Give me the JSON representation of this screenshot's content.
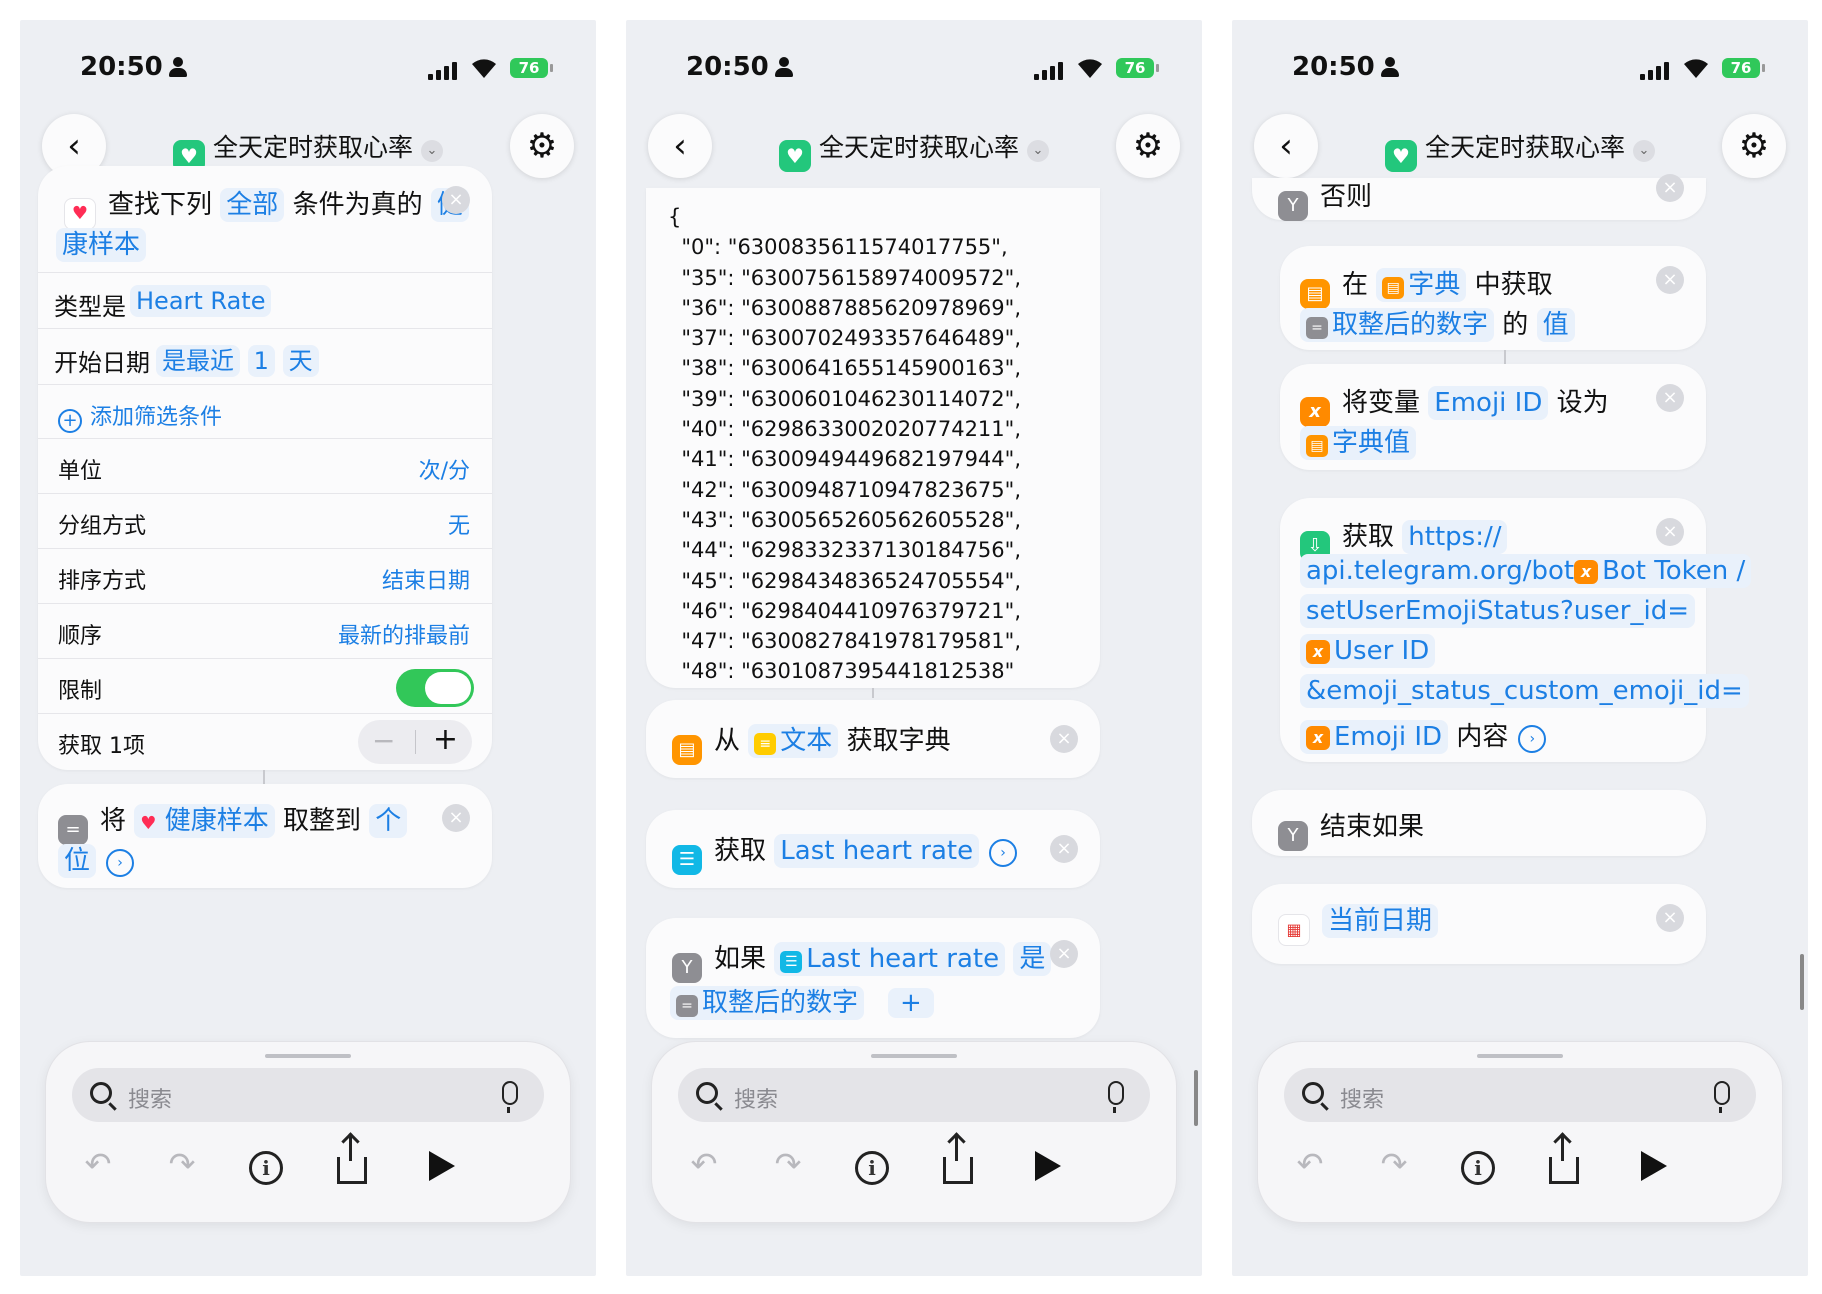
{
  "status": {
    "time": "20:50",
    "battery": "76"
  },
  "nav": {
    "title": "全天定时获取心率"
  },
  "search": {
    "placeholder": "搜索"
  },
  "p1": {
    "find": {
      "prefix": "查找下列",
      "all": "全部",
      "mid": "条件为真的",
      "tok_a": "健",
      "tok_b": "康样本"
    },
    "type": {
      "label": "类型是",
      "value": "Heart Rate"
    },
    "start": {
      "label": "开始日期",
      "op": "是最近",
      "num": "1",
      "unit": "天"
    },
    "add_filter": "添加筛选条件",
    "rows": [
      {
        "label": "单位",
        "value": "次/分"
      },
      {
        "label": "分组方式",
        "value": "无"
      },
      {
        "label": "排序方式",
        "value": "结束日期"
      },
      {
        "label": "顺序",
        "value": "最新的排最前"
      }
    ],
    "limit_label": "限制",
    "fetch_label": "获取 1项",
    "round": {
      "a": "将",
      "sample": "健康样本",
      "b": "取整到",
      "tok_a": "个",
      "tok_b": "位"
    }
  },
  "p2": {
    "json_lines": [
      "{",
      "  \"0\": \"6300835611574017755\",",
      "  \"35\": \"6300756158974009572\",",
      "  \"36\": \"6300887885620978969\",",
      "  \"37\": \"6300702493357646489\",",
      "  \"38\": \"6300641655145900163\",",
      "  \"39\": \"6300601046230114072\",",
      "  \"40\": \"6298633002020774211\",",
      "  \"41\": \"6300949449682197944\",",
      "  \"42\": \"6300948710947823675\",",
      "  \"43\": \"6300565260562605528\",",
      "  \"44\": \"6298332337130184756\",",
      "  \"45\": \"6298434836524705554\",",
      "  \"46\": \"6298404410976379721\",",
      "  \"47\": \"6300827841978179581\",",
      "  \"48\": \"6301087395441812538\""
    ],
    "dict": {
      "from": "从",
      "text": "文本",
      "get": "获取字典"
    },
    "getvar": {
      "get": "获取",
      "var": "Last heart rate"
    },
    "ifc": {
      "if": "如果",
      "var": "Last heart rate",
      "is": "是",
      "rounded": "取整后的数字"
    }
  },
  "p3": {
    "otherwise": "否则",
    "getval": {
      "in": "在",
      "dict": "字典",
      "mid": "中获取",
      "rounded": "取整后的数字",
      "of": "的",
      "val": "值"
    },
    "setvar": {
      "a": "将变量",
      "var": "Emoji ID",
      "b": "设为",
      "value": "字典值"
    },
    "url": {
      "get": "获取",
      "l1": "https://",
      "l2a": "api.telegram.org/bot",
      "bot": "Bot Token",
      "slash": "/",
      "l3": "setUserEmojiStatus?user_id=",
      "user": "User ID",
      "l5": "&emoji_status_custom_emoji_id=",
      "emoji": "Emoji ID",
      "content": "内容"
    },
    "endif": "结束如果",
    "date": "当前日期"
  },
  "colors": {
    "accent": "#1c7fe4",
    "toggle_on": "#32c759",
    "health_green": "#23c77c",
    "variable_orange": "#ff8a00",
    "dict_orange": "#ff9500",
    "scripting_gray": "#8e8e93"
  }
}
